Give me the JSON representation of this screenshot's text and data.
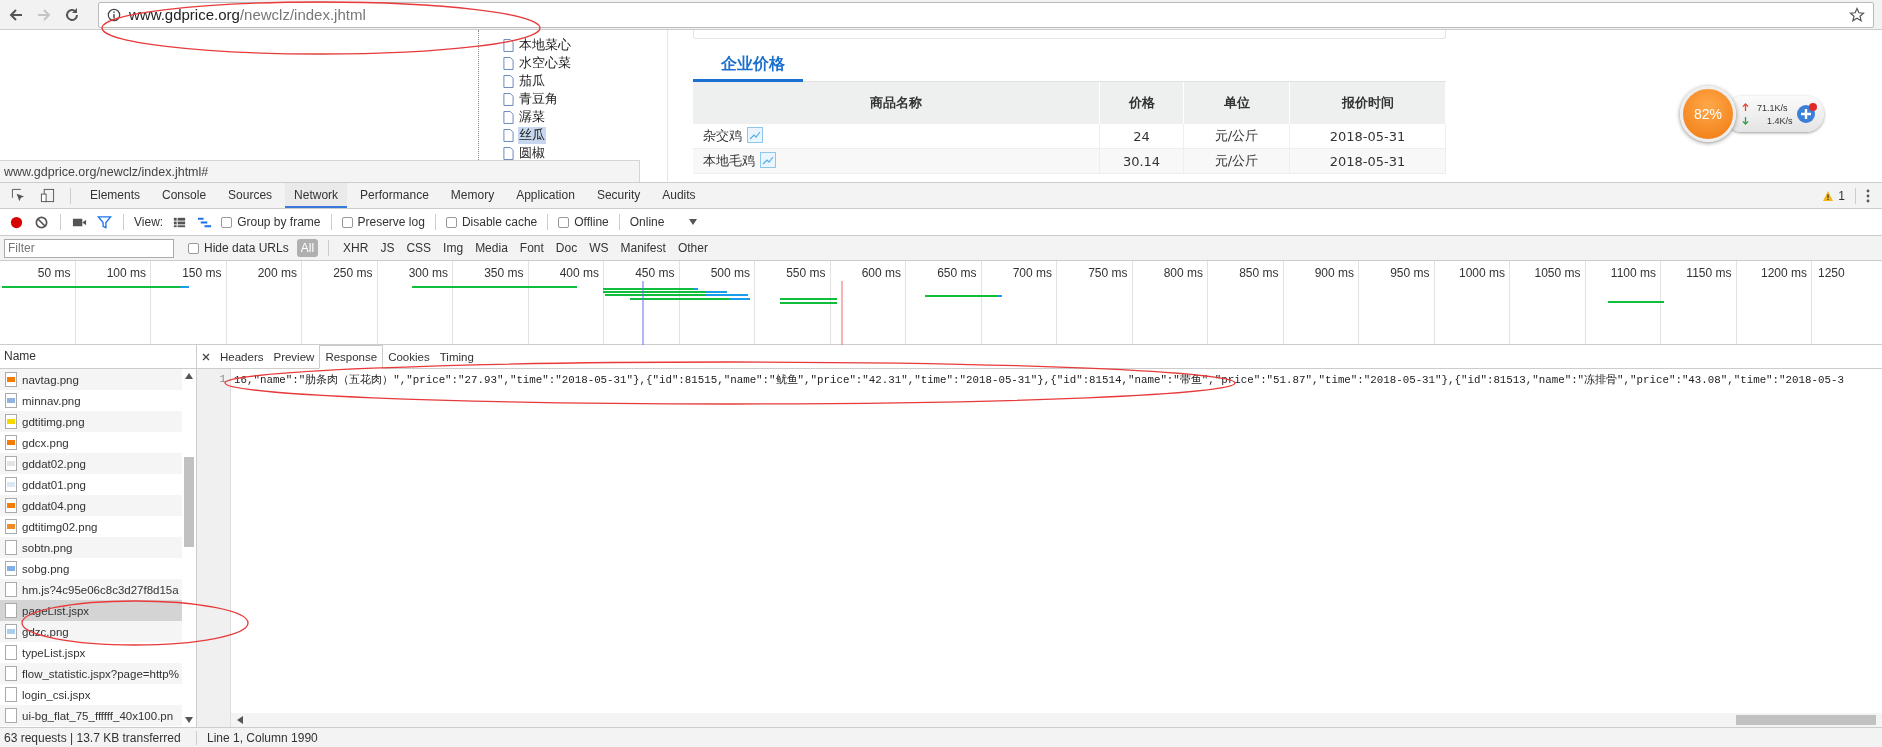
{
  "browser": {
    "url_host": "www.gdprice.org",
    "url_path": "/newclz/index.jhtml",
    "status_url": "www.gdprice.org/newclz/index.jhtml#"
  },
  "page": {
    "tree_items": [
      {
        "label": "本地菜心",
        "selected": false
      },
      {
        "label": "水空心菜",
        "selected": false
      },
      {
        "label": "茄瓜",
        "selected": false
      },
      {
        "label": "青豆角",
        "selected": false
      },
      {
        "label": "潺菜",
        "selected": false
      },
      {
        "label": "丝瓜",
        "selected": true
      },
      {
        "label": "圆椒",
        "selected": false
      }
    ],
    "price_section": {
      "title": "企业价格",
      "columns": [
        "商品名称",
        "价格",
        "单位",
        "报价时间"
      ],
      "rows": [
        [
          "杂交鸡",
          "24",
          "元/公斤",
          "2018-05-31"
        ],
        [
          "本地毛鸡",
          "30.14",
          "元/公斤",
          "2018-05-31"
        ]
      ]
    }
  },
  "speed_widget": {
    "percent": "82%",
    "upload": "71.1K/s",
    "download": "1.4K/s"
  },
  "devtools": {
    "tabs": [
      {
        "label": "Elements",
        "selected": false
      },
      {
        "label": "Console",
        "selected": false
      },
      {
        "label": "Sources",
        "selected": false
      },
      {
        "label": "Network",
        "selected": true
      },
      {
        "label": "Performance",
        "selected": false
      },
      {
        "label": "Memory",
        "selected": false
      },
      {
        "label": "Application",
        "selected": false
      },
      {
        "label": "Security",
        "selected": false
      },
      {
        "label": "Audits",
        "selected": false
      }
    ],
    "warning_count": "1",
    "toolbar": {
      "view_label": "View:",
      "checkboxes": [
        {
          "label": "Group by frame",
          "checked": false
        },
        {
          "label": "Preserve log",
          "checked": false
        },
        {
          "label": "Disable cache",
          "checked": false
        },
        {
          "label": "Offline",
          "checked": false
        }
      ],
      "throttle": "Online"
    },
    "filter": {
      "placeholder": "Filter",
      "hide_data_urls": {
        "label": "Hide data URLs",
        "checked": false
      },
      "types": [
        {
          "label": "All",
          "selected": true
        },
        {
          "label": "XHR",
          "selected": false
        },
        {
          "label": "JS",
          "selected": false
        },
        {
          "label": "CSS",
          "selected": false
        },
        {
          "label": "Img",
          "selected": false
        },
        {
          "label": "Media",
          "selected": false
        },
        {
          "label": "Font",
          "selected": false
        },
        {
          "label": "Doc",
          "selected": false
        },
        {
          "label": "WS",
          "selected": false
        },
        {
          "label": "Manifest",
          "selected": false
        },
        {
          "label": "Other",
          "selected": false
        }
      ]
    },
    "timeline_ticks": [
      "50 ms",
      "100 ms",
      "150 ms",
      "200 ms",
      "250 ms",
      "300 ms",
      "350 ms",
      "400 ms",
      "450 ms",
      "500 ms",
      "550 ms",
      "600 ms",
      "650 ms",
      "700 ms",
      "750 ms",
      "800 ms",
      "850 ms",
      "900 ms",
      "950 ms",
      "1000 ms",
      "1050 ms",
      "1100 ms",
      "1150 ms",
      "1200 ms",
      "1250"
    ],
    "requests": {
      "header": "Name",
      "items": [
        {
          "name": "navtag.png",
          "color": "#f57c00",
          "selected": false
        },
        {
          "name": "minnav.png",
          "color": "#90b4e0",
          "selected": false
        },
        {
          "name": "gdtitimg.png",
          "color": "#f5d800",
          "selected": false
        },
        {
          "name": "gdcx.png",
          "color": "#f57c00",
          "selected": false
        },
        {
          "name": "gddat02.png",
          "color": "#e4e4e4",
          "selected": false
        },
        {
          "name": "gddat01.png",
          "color": "#dde8f4",
          "selected": false
        },
        {
          "name": "gddat04.png",
          "color": "#f57c00",
          "selected": false
        },
        {
          "name": "gdtitimg02.png",
          "color": "#f08a24",
          "selected": false
        },
        {
          "name": "sobtn.png",
          "selected": false
        },
        {
          "name": "sobg.png",
          "color": "#7fb0e6",
          "selected": false
        },
        {
          "name": "hm.js?4c95e06c8c3d27f8d15a",
          "selected": false
        },
        {
          "name": "pageList.jspx",
          "selected": true
        },
        {
          "name": "gdzc.png",
          "color": "#a8d0ee",
          "selected": false
        },
        {
          "name": "typeList.jspx",
          "selected": false
        },
        {
          "name": "flow_statistic.jspx?page=http%",
          "selected": false
        },
        {
          "name": "login_csi.jspx",
          "selected": false
        },
        {
          "name": "ui-bg_flat_75_ffffff_40x100.pn",
          "selected": false
        }
      ]
    },
    "detail_tabs": [
      {
        "label": "Headers",
        "selected": false
      },
      {
        "label": "Preview",
        "selected": false
      },
      {
        "label": "Response",
        "selected": true
      },
      {
        "label": "Cookies",
        "selected": false
      },
      {
        "label": "Timing",
        "selected": false
      }
    ],
    "response": {
      "line_number": "1",
      "text": "16,\"name\":\"肋条肉（五花肉）\",\"price\":\"27.93\",\"time\":\"2018-05-31\"},{\"id\":81515,\"name\":\"鱿鱼\",\"price\":\"42.31\",\"time\":\"2018-05-31\"},{\"id\":81514,\"name\":\"带鱼\",\"price\":\"51.87\",\"time\":\"2018-05-31\"},{\"id\":81513,\"name\":\"冻排骨\",\"price\":\"43.08\",\"time\":\"2018-05-3"
    },
    "status": {
      "summary": "63 requests | 13.7 KB transferred",
      "cursor": "Line 1, Column 1990"
    }
  }
}
